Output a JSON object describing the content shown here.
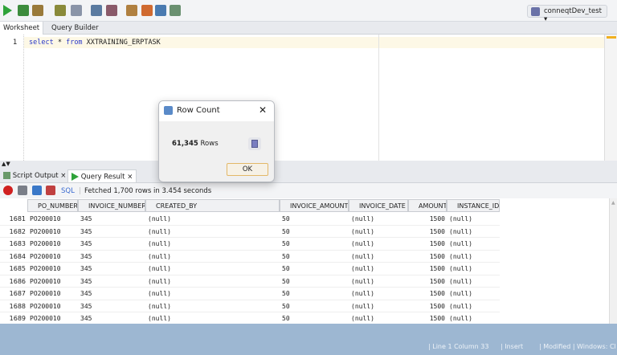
{
  "toolbar": {
    "connection": "conneqtDev_test",
    "icons": [
      "run-statement-icon",
      "run-script-icon",
      "commit-icon",
      "rollback-icon",
      "explain-icon",
      "autotrace-icon",
      "sql-tuning-icon",
      "clear-icon",
      "sql-history-icon",
      "format-icon"
    ]
  },
  "tabs": [
    {
      "label": "Worksheet"
    },
    {
      "label": "Query Builder"
    }
  ],
  "editor": {
    "line_number": "1",
    "code_kw1": "select",
    "code_star": " * ",
    "code_kw2": "from",
    "code_table": " XXTRAINING_ERPTASK"
  },
  "result_tabs": [
    {
      "label": "Script Output",
      "close": "×"
    },
    {
      "label": "Query Result",
      "close": "×"
    }
  ],
  "result_toolbar": {
    "sql_label": "SQL",
    "status": "Fetched 1,700 rows in 3.454 seconds"
  },
  "grid": {
    "columns": [
      "PO_NUMBER",
      "INVOICE_NUMBER",
      "CREATED_BY",
      "INVOICE_AMOUNT",
      "INVOICE_DATE",
      "AMOUNT",
      "INSTANCE_ID"
    ],
    "rows": [
      [
        "1681",
        "PO200010",
        "345",
        "(null)",
        "50",
        "(null)",
        "1500",
        "(null)"
      ],
      [
        "1682",
        "PO200010",
        "345",
        "(null)",
        "50",
        "(null)",
        "1500",
        "(null)"
      ],
      [
        "1683",
        "PO200010",
        "345",
        "(null)",
        "50",
        "(null)",
        "1500",
        "(null)"
      ],
      [
        "1684",
        "PO200010",
        "345",
        "(null)",
        "50",
        "(null)",
        "1500",
        "(null)"
      ],
      [
        "1685",
        "PO200010",
        "345",
        "(null)",
        "50",
        "(null)",
        "1500",
        "(null)"
      ],
      [
        "1686",
        "PO200010",
        "345",
        "(null)",
        "50",
        "(null)",
        "1500",
        "(null)"
      ],
      [
        "1687",
        "PO200010",
        "345",
        "(null)",
        "50",
        "(null)",
        "1500",
        "(null)"
      ],
      [
        "1688",
        "PO200010",
        "345",
        "(null)",
        "50",
        "(null)",
        "1500",
        "(null)"
      ],
      [
        "1689",
        "PO200010",
        "345",
        "(null)",
        "50",
        "(null)",
        "1500",
        "(null)"
      ]
    ]
  },
  "dialog": {
    "title": "Row Count",
    "count": "61,345",
    "rows_label": "Rows",
    "ok": "OK",
    "close": "✕"
  },
  "status": {
    "position": "| Line 1 Column 33",
    "mode": "| Insert",
    "modified": "| Modified |",
    "encoding": "Windows: Cl"
  }
}
